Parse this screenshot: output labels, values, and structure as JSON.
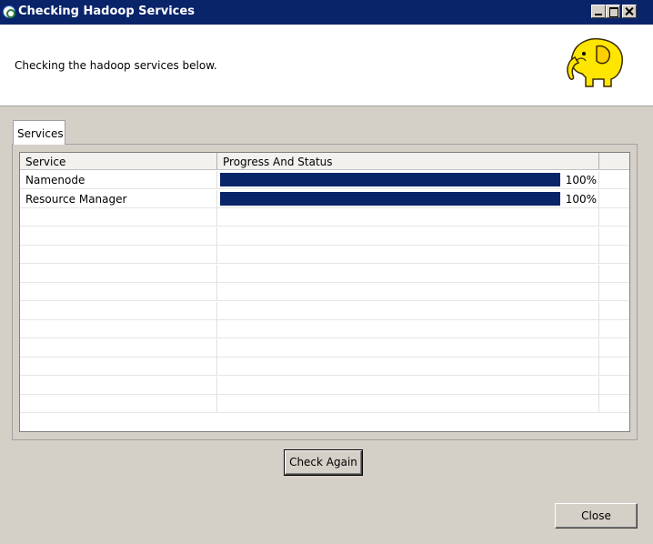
{
  "window": {
    "title": "Checking Hadoop Services",
    "icon": "app-icon"
  },
  "header": {
    "text": "Checking the hadoop services below.",
    "logo": "hadoop-elephant"
  },
  "tabs": [
    {
      "label": "Services",
      "selected": true
    }
  ],
  "table": {
    "columns": [
      "Service",
      "Progress And Status",
      ""
    ],
    "rows": [
      {
        "service": "Namenode",
        "progress": 100,
        "status": "100%"
      },
      {
        "service": "Resource Manager",
        "progress": 100,
        "status": "100%"
      }
    ],
    "empty_rows": 11
  },
  "buttons": {
    "check_again": "Check Again",
    "close": "Close"
  },
  "colors": {
    "titlebar": "#0a246a",
    "progress_fill": "#0a246a",
    "elephant": "#ffe600"
  }
}
